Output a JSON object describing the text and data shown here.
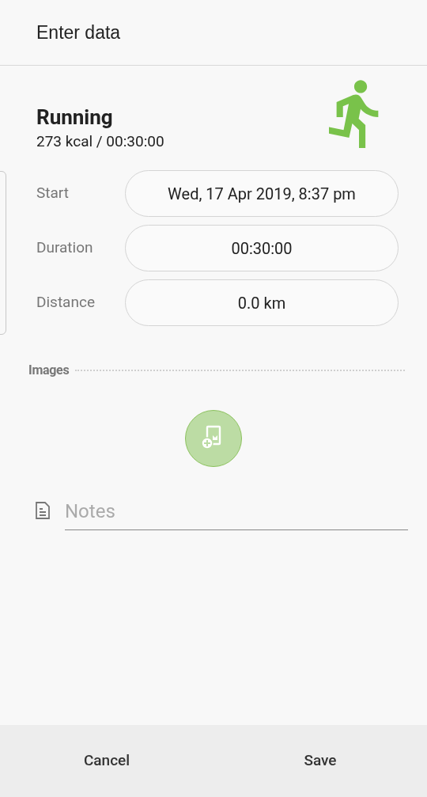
{
  "header": {
    "title": "Enter data"
  },
  "activity": {
    "name": "Running",
    "summary": "273 kcal / 00:30:00"
  },
  "fields": [
    {
      "label": "Start",
      "value": "Wed, 17 Apr 2019, 8:37 pm"
    },
    {
      "label": "Duration",
      "value": "00:30:00"
    },
    {
      "label": "Distance",
      "value": "0.0 km"
    }
  ],
  "images": {
    "label": "Images"
  },
  "notes": {
    "placeholder": "Notes"
  },
  "buttons": [
    "Cancel",
    "Save"
  ]
}
